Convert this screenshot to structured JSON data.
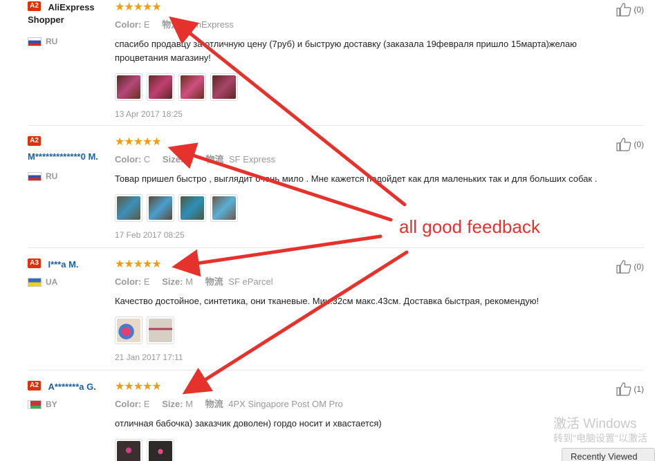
{
  "reviews": [
    {
      "level": "A2",
      "name": "AliExpress Shopper",
      "name_style": "dark",
      "country": "RU",
      "flag": "ru",
      "stars": "★★★★★",
      "color_label": "Color:",
      "color_value": "E",
      "size_label": "",
      "size_value": "",
      "ship_label": "物流",
      "ship_value": "SunExpress",
      "text": "спасибо продавцу за отличную цену (7руб) и быструю доставку (заказала 19февраля пришло 15марта)желаю процветания магазину!",
      "thumbs": [
        "#b4487a",
        "#8a3050",
        "#a0405f",
        "#9a3c5c"
      ],
      "date": "13 Apr 2017 18:25",
      "helpful": "(0)"
    },
    {
      "level": "A2",
      "name": "M*************0 M.",
      "name_style": "blue",
      "country": "RU",
      "flag": "ru",
      "stars": "★★★★★",
      "color_label": "Color:",
      "color_value": "C",
      "size_label": "Size:",
      "size_value": "M",
      "ship_label": "物流",
      "ship_value": "SF Express",
      "text": "Товар пришел быстро , выглядит очень мило . Мне кажется подойдет как для маленьких так и для больших собак .",
      "thumbs": [
        "#3d7f9a",
        "#4a8fb0",
        "#2d6f88",
        "#5a9fc0"
      ],
      "date": "17 Feb 2017 08:25",
      "helpful": "(0)"
    },
    {
      "level": "A3",
      "name": "I***a M.",
      "name_style": "blue",
      "country": "UA",
      "flag": "ua",
      "stars": "★★★★★",
      "color_label": "Color:",
      "color_value": "E",
      "size_label": "Size:",
      "size_value": "M",
      "ship_label": "物流",
      "ship_value": "SF eParcel",
      "text": "Качество достойное, синтетика, они тканевые. Мин.32см макс.43см. Доставка быстрая, рекомендую!",
      "thumbs": [
        "#d06a8a",
        "#c4a090"
      ],
      "date": "21 Jan 2017 17:11",
      "helpful": "(0)"
    },
    {
      "level": "A2",
      "name": "A*******a G.",
      "name_style": "blue",
      "country": "BY",
      "flag": "by",
      "stars": "★★★★★",
      "color_label": "Color:",
      "color_value": "E",
      "size_label": "Size:",
      "size_value": "M",
      "ship_label": "物流",
      "ship_value": "4PX Singapore Post OM Pro",
      "text": "отличная бабочка) заказчик доволен) гордо носит и хвастается)",
      "thumbs": [
        "#3a3030",
        "#2f2a2a"
      ],
      "date": "",
      "helpful": "(1)"
    }
  ],
  "annotation": "all good feedback",
  "annotation_color": "#e5322d",
  "watermark": {
    "line1": "激活 Windows",
    "line2": "转到\"电脑设置\"以激活"
  },
  "recently_viewed": "Recently Viewed"
}
